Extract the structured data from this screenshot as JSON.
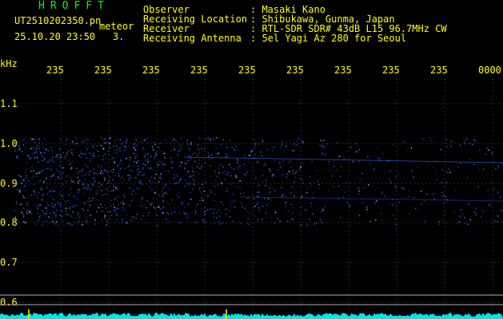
{
  "header": {
    "brand": "HROFFT",
    "filename": "UT2510202350.pn",
    "meteor_label": "meteor",
    "datetime": "25.10.20 23:50",
    "count": "3.",
    "meta": [
      {
        "key": "Observer",
        "value": ": Masaki Kano"
      },
      {
        "key": "Receiving Location",
        "value": ": Shibukawa, Gunma, Japan"
      },
      {
        "key": "Receiver",
        "value": ": RTL-SDR SDR# 43dB L15 96.7MHz CW"
      },
      {
        "key": "Receiving Antenna",
        "value": ": 5el Yagi Az 280 for Seoul"
      }
    ]
  },
  "spectrogram": {
    "freq_unit": "kHz",
    "y_ticks": [
      "1.1",
      "1.0",
      "0.9",
      "0.8",
      "0.7",
      "0.6"
    ],
    "time_ticks": [
      "235",
      "235",
      "235",
      "235",
      "235",
      "235",
      "235",
      "235",
      "235",
      "0000"
    ],
    "colors": {
      "label": "#ffff00",
      "grid": "#505050",
      "signal": "#4060ff",
      "signal_bright": "#a0c0ff",
      "baseline": "#00ffff",
      "hline": "#b0b0b0"
    }
  }
}
